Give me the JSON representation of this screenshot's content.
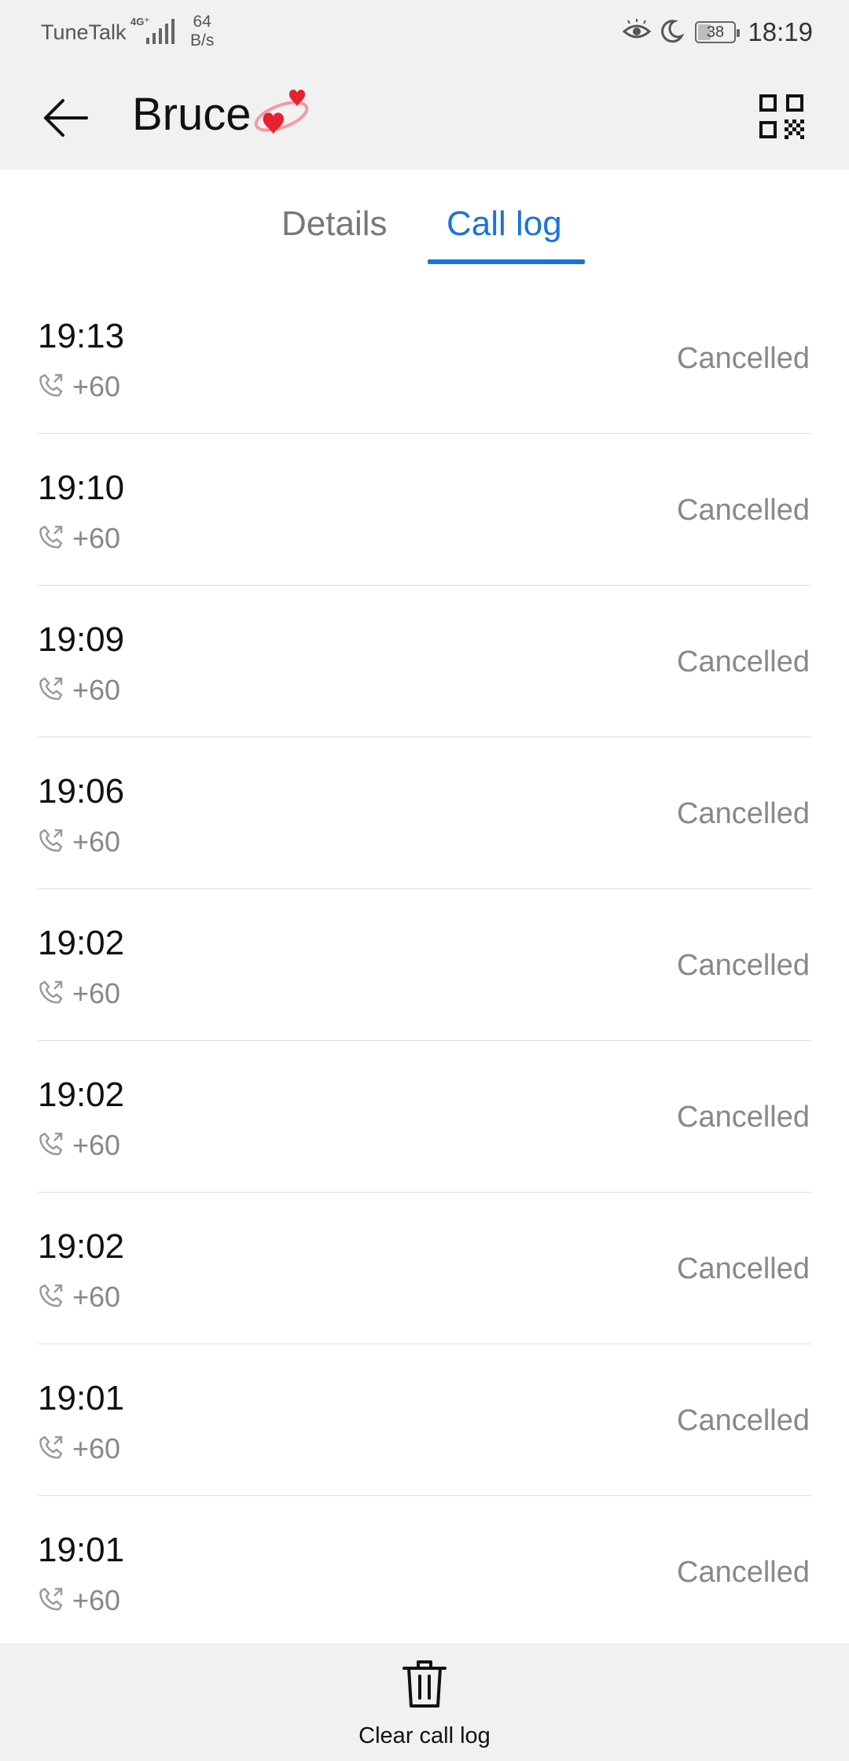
{
  "status_bar": {
    "carrier": "TuneTalk",
    "network_type": "4G⁺",
    "speed_value": "64",
    "speed_unit": "B/s",
    "battery_level": "38",
    "time": "18:19"
  },
  "header": {
    "contact_name": "Bruce",
    "back_icon": "back-arrow-icon",
    "qr_icon": "qr-code-icon",
    "emoji_icon": "two-hearts-icon"
  },
  "tabs": [
    {
      "label": "Details",
      "active": false
    },
    {
      "label": "Call log",
      "active": true
    }
  ],
  "colors": {
    "accent": "#1a73d9",
    "bar_background": "#f1f1f1",
    "secondary_text": "#888888"
  },
  "call_log": [
    {
      "time": "19:13",
      "number": "+60",
      "status": "Cancelled"
    },
    {
      "time": "19:10",
      "number": "+60",
      "status": "Cancelled"
    },
    {
      "time": "19:09",
      "number": "+60",
      "status": "Cancelled"
    },
    {
      "time": "19:06",
      "number": "+60",
      "status": "Cancelled"
    },
    {
      "time": "19:02",
      "number": "+60",
      "status": "Cancelled"
    },
    {
      "time": "19:02",
      "number": "+60",
      "status": "Cancelled"
    },
    {
      "time": "19:02",
      "number": "+60",
      "status": "Cancelled"
    },
    {
      "time": "19:01",
      "number": "+60",
      "status": "Cancelled"
    },
    {
      "time": "19:01",
      "number": "+60",
      "status": "Cancelled"
    }
  ],
  "bottom_bar": {
    "clear_label": "Clear call log",
    "clear_icon": "trash-icon"
  }
}
